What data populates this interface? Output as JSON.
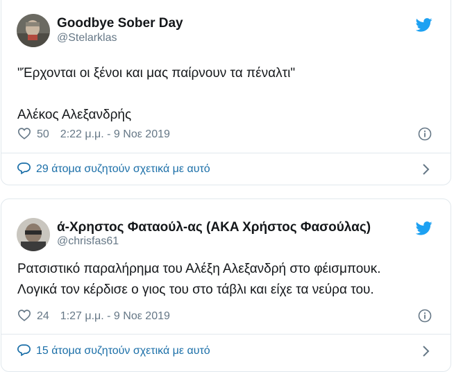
{
  "tweets": [
    {
      "display_name": "Goodbye Sober Day",
      "handle": "@Stelarklas",
      "text": "\"Έρχονται οι ξένοι και μας παίρνουν τα πέναλτι\"\n\nΑλέκος Αλεξανδρής",
      "likes": "50",
      "timestamp": "2:22 μ.μ. - 9 Νοε 2019",
      "conversation": "29 άτομα συζητούν σχετικά με αυτό"
    },
    {
      "display_name": "ά-Χρηστος Φαταούλ-ας (AKA Χρήστος Φασούλας)",
      "handle": "@chrisfas61",
      "text": "Ρατσιστικό παραλήρημα του Αλέξη Αλεξανδρή στο φέισμπουκ.\nΛογικά τον κέρδισε ο γιος του στο τάβλι και είχε τα νεύρα του.",
      "likes": "24",
      "timestamp": "1:27 μ.μ. - 9 Νοε 2019",
      "conversation": "15 άτομα συζητούν σχετικά με αυτό"
    }
  ],
  "colors": {
    "twitter_blue": "#1da1f2",
    "link_blue": "#1b6fa8",
    "secondary_text": "#657786",
    "border": "#e1e8ed"
  },
  "icons": [
    "heart-icon",
    "info-icon",
    "comment-bubble-icon",
    "chevron-right-icon",
    "twitter-bird-icon"
  ]
}
